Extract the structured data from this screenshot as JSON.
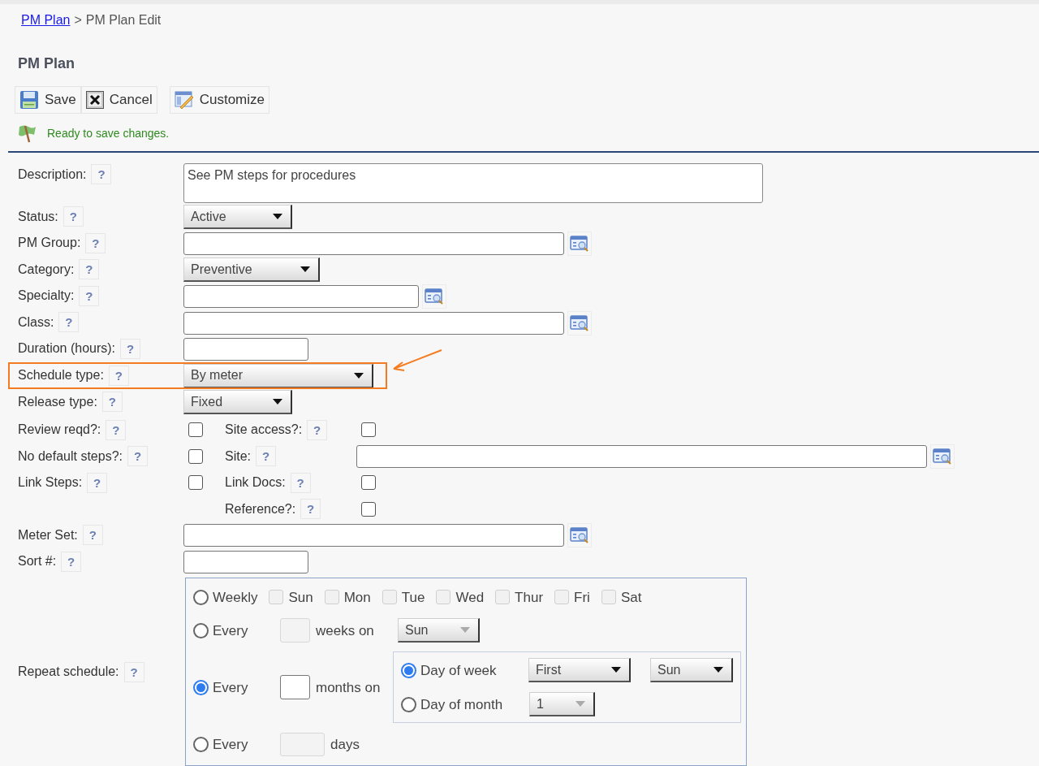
{
  "breadcrumb": {
    "link": "PM Plan",
    "separator": ">",
    "current": "PM Plan Edit"
  },
  "title": "PM Plan",
  "toolbar": [
    {
      "kind": "save",
      "label": "Save"
    },
    {
      "kind": "cancel",
      "label": "Cancel"
    },
    {
      "kind": "customize",
      "label": "Customize"
    }
  ],
  "status_message": "Ready to save changes.",
  "fields": [
    {
      "label": "Description:",
      "help": "?",
      "kind": "textarea",
      "value": "See PM steps for procedures",
      "highlighted": false
    },
    {
      "label": "Status:",
      "help": "?",
      "kind": "select",
      "value": "Active",
      "highlighted": false
    },
    {
      "label": "PM Group:",
      "help": "?",
      "kind": "lookup",
      "highlighted": false
    },
    {
      "label": "Category:",
      "help": "?",
      "kind": "select",
      "value": "Preventive",
      "highlighted": false
    },
    {
      "label": "Specialty:",
      "help": "?",
      "kind": "lookup",
      "highlighted": false
    },
    {
      "label": "Class:",
      "help": "?",
      "kind": "lookup",
      "highlighted": false
    },
    {
      "label": "Duration (hours):",
      "help": "?",
      "kind": "text",
      "highlighted": false
    },
    {
      "label": "Schedule type:",
      "help": "?",
      "kind": "select",
      "value": "By meter",
      "highlighted": true
    },
    {
      "label": "Release type:",
      "help": "?",
      "kind": "select",
      "value": "Fixed",
      "highlighted": false
    }
  ],
  "flags": [
    {
      "left": {
        "label": "Review reqd?:",
        "help": "?",
        "kind": "checkbox",
        "checked": false
      },
      "right": {
        "label": "Site access?:",
        "help": "?",
        "kind": "checkbox",
        "checked": false
      }
    },
    {
      "left": {
        "label": "No default steps?:",
        "help": "?",
        "kind": "checkbox",
        "checked": false
      },
      "right": {
        "label": "Site:",
        "help": "?",
        "kind": "lookup"
      }
    },
    {
      "left": {
        "label": "Link Steps:",
        "help": "?",
        "kind": "checkbox",
        "checked": false
      },
      "right": {
        "label": "Link Docs:",
        "help": "?",
        "kind": "checkbox",
        "checked": false
      }
    },
    {
      "right": {
        "label": "Reference?:",
        "help": "?",
        "kind": "checkbox",
        "checked": false
      }
    }
  ],
  "fields_after": [
    {
      "label": "Meter Set:",
      "help": "?",
      "kind": "lookup",
      "highlighted": false
    },
    {
      "label": "Sort #:",
      "help": "?",
      "kind": "text",
      "highlighted": false
    }
  ],
  "repeat_schedule": {
    "label": "Repeat schedule:",
    "help": "?",
    "options": [
      {
        "kind": "weekly",
        "label": "Weekly",
        "selected": false,
        "days": [
          {
            "label": "Sun",
            "checked": false
          },
          {
            "label": "Mon",
            "checked": false
          },
          {
            "label": "Tue",
            "checked": false
          },
          {
            "label": "Wed",
            "checked": false
          },
          {
            "label": "Thur",
            "checked": false
          },
          {
            "label": "Fri",
            "checked": false
          },
          {
            "label": "Sat",
            "checked": false
          }
        ]
      },
      {
        "kind": "weeks",
        "label": "Every",
        "selected": false,
        "unit": "weeks on",
        "day": "Sun"
      },
      {
        "kind": "months",
        "label": "Every",
        "selected": true,
        "unit": "months on",
        "modes": [
          {
            "label": "Day of week",
            "selected": true,
            "selects": [
              "First",
              "Sun"
            ]
          },
          {
            "label": "Day of month",
            "selected": false,
            "selects": [
              "1"
            ]
          }
        ]
      },
      {
        "kind": "days",
        "label": "Every",
        "selected": false,
        "unit": "days"
      }
    ]
  }
}
